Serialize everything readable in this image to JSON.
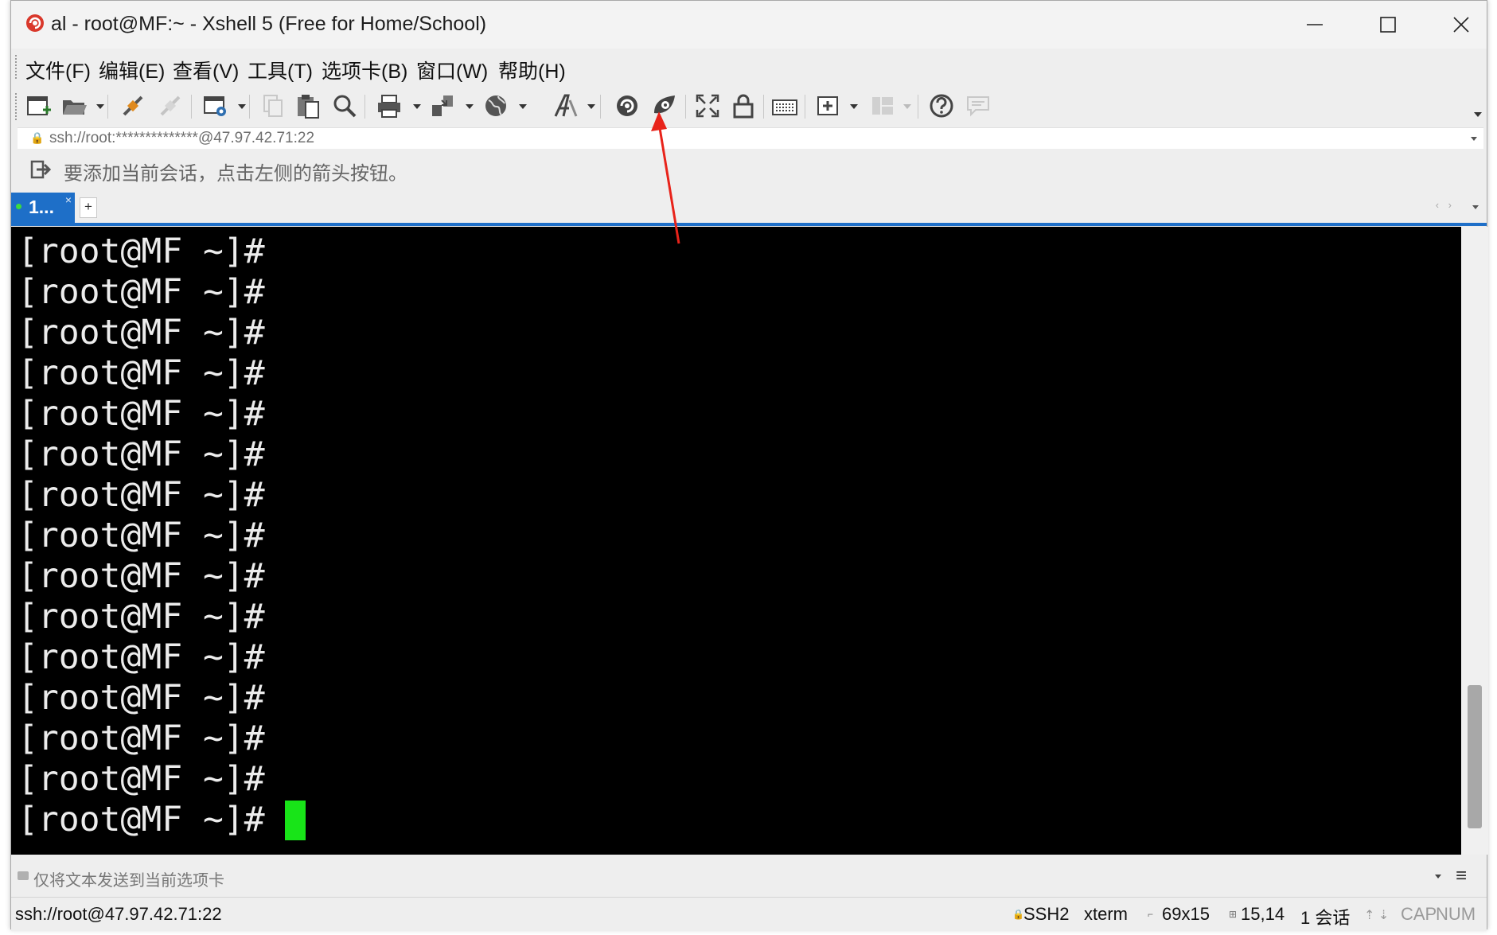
{
  "window": {
    "title": "al - root@MF:~ - Xshell 5 (Free for Home/School)",
    "accent_color": "#1e6fc8",
    "app_icon": "xshell-logo-icon"
  },
  "window_controls": {
    "minimize_icon": "minimize-icon",
    "maximize_icon": "maximize-icon",
    "close_icon": "close-icon"
  },
  "menu": {
    "items": [
      "文件(F)",
      "编辑(E)",
      "查看(V)",
      "工具(T)",
      "选项卡(B)",
      "窗口(W)",
      "帮助(H)"
    ]
  },
  "toolbar": {
    "icons": [
      "new-session-icon",
      "open-folder-icon",
      "reconnect-icon",
      "disconnect-icon",
      "properties-icon",
      "copy-icon",
      "paste-icon",
      "find-icon",
      "print-icon",
      "transfer-icon",
      "globe-icon",
      "font-icon",
      "xftp-icon",
      "xmanager-icon",
      "fullscreen-icon",
      "lock-icon",
      "keyboard-icon",
      "add-icon",
      "layout-icon",
      "help-icon",
      "chat-icon"
    ]
  },
  "address": {
    "url": "ssh://root:**************@47.97.42.71:22"
  },
  "hint": {
    "text": "要添加当前会话，点击左侧的箭头按钮。"
  },
  "tabs": {
    "active_label": "1...",
    "close_glyph": "×",
    "new_tab_glyph": "+"
  },
  "terminal": {
    "lines": [
      "[root@MF ~]#",
      "[root@MF ~]#",
      "[root@MF ~]#",
      "[root@MF ~]#",
      "[root@MF ~]#",
      "[root@MF ~]#",
      "[root@MF ~]#",
      "[root@MF ~]#",
      "[root@MF ~]#",
      "[root@MF ~]#",
      "[root@MF ~]#",
      "[root@MF ~]#",
      "[root@MF ~]#",
      "[root@MF ~]#",
      "[root@MF ~]# "
    ],
    "background": "#000000",
    "foreground": "#ececec",
    "cursor_color": "#18e418"
  },
  "sendbar": {
    "text": "仅将文本发送到当前选项卡"
  },
  "status": {
    "connection": "ssh://root@47.97.42.71:22",
    "protocol": "SSH2",
    "terminal_type": "xterm",
    "size": "69x15",
    "cursor_pos": "15,14",
    "sessions": "1 会话",
    "caps": "CAP",
    "num": "NUM"
  },
  "annotation": {
    "color": "#e8231a"
  }
}
